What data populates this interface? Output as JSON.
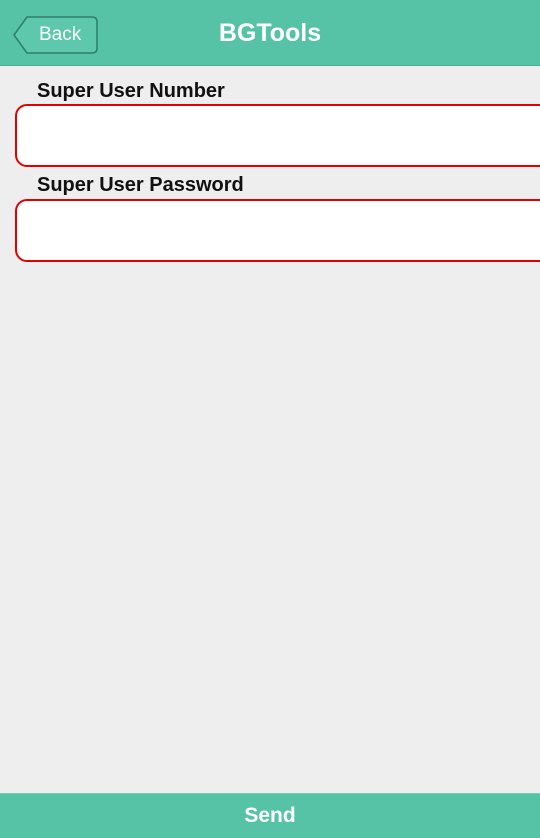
{
  "header": {
    "back_label": "Back",
    "title": "BGTools"
  },
  "form": {
    "number_label": "Super User Number",
    "number_value": "",
    "password_label": "Super User Password",
    "password_value": ""
  },
  "footer": {
    "send_label": "Send"
  },
  "colors": {
    "header_bg": "#56c2a6",
    "input_border": "#e30000",
    "page_bg": "#eeeeee"
  }
}
